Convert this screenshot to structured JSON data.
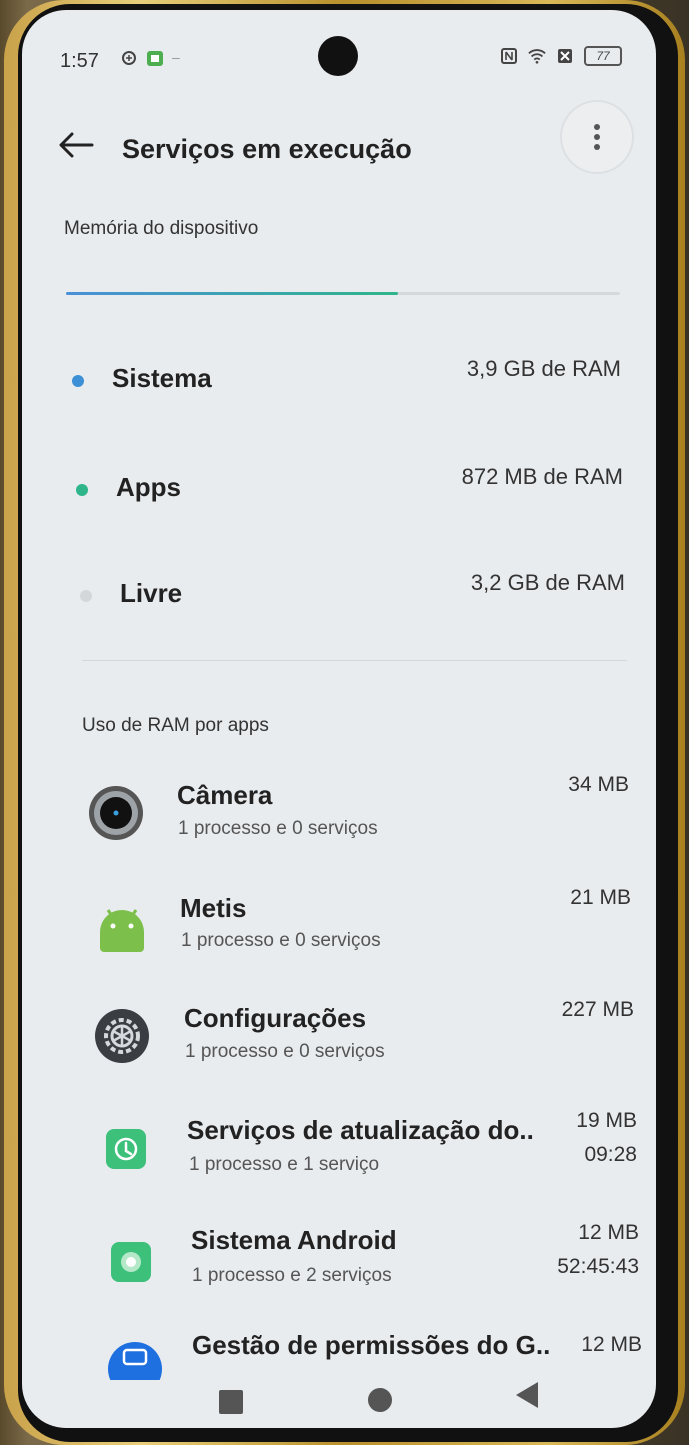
{
  "status_bar": {
    "time": "1:57",
    "battery": "77"
  },
  "header": {
    "title": "Serviços em execução"
  },
  "memory": {
    "label": "Memória do dispositivo",
    "used_fraction": 0.6,
    "legend": [
      {
        "name": "Sistema",
        "value": "3,9 GB de RAM",
        "color": "#3d8fd6"
      },
      {
        "name": "Apps",
        "value": "872 MB de RAM",
        "color": "#2fb58a"
      },
      {
        "name": "Livre",
        "value": "3,2 GB de RAM",
        "color": "#d4d7da"
      }
    ]
  },
  "apps_section": {
    "label": "Uso de RAM por apps",
    "apps": [
      {
        "name": "Câmera",
        "sub": "1 processo e 0 serviços",
        "value": "34 MB",
        "time": "",
        "icon": "camera-icon"
      },
      {
        "name": "Metis",
        "sub": "1 processo e 0 serviços",
        "value": "21 MB",
        "time": "",
        "icon": "android-icon"
      },
      {
        "name": "Configurações",
        "sub": "1 processo e 0 serviços",
        "value": "227 MB",
        "time": "",
        "icon": "gear-icon"
      },
      {
        "name": "Serviços de atualização do..",
        "sub": "1 processo e 1 serviço",
        "value": "19 MB",
        "time": "09:28",
        "icon": "update-icon"
      },
      {
        "name": "Sistema Android",
        "sub": "1 processo e 2 serviços",
        "value": "12 MB",
        "time": "52:45:43",
        "icon": "android-system-icon"
      },
      {
        "name": "Gestão de permissões do G..",
        "sub": "",
        "value": "12 MB",
        "time": "",
        "icon": "permissions-icon"
      }
    ]
  },
  "colors": {
    "accent_blue": "#3d8fd6",
    "accent_green": "#2fb58a",
    "background": "#e9ecef"
  }
}
